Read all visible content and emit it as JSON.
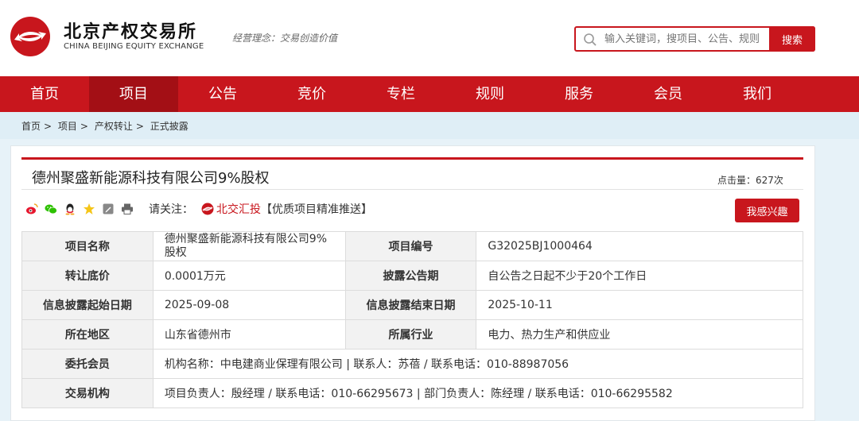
{
  "header": {
    "brand_cn": "北京产权交易所",
    "brand_en": "CHINA BEIJING EQUITY EXCHANGE",
    "slogan": "经营理念：交易创造价值",
    "search_placeholder": "输入关键词，搜项目、公告、规则…",
    "search_button": "搜索",
    "brand_color": "#c8161d"
  },
  "nav": [
    "首页",
    "项目",
    "公告",
    "竞价",
    "专栏",
    "规则",
    "服务",
    "会员",
    "我们"
  ],
  "nav_active": 1,
  "breadcrumb": [
    "首页",
    "项目",
    "产权转让",
    "正式披露"
  ],
  "project": {
    "title": "德州聚盛新能源科技有限公司9%股权",
    "clicks": "点击量：627次",
    "follow_label": "请关注：",
    "follow_name": "北交汇投",
    "follow_slogan": "【优质项目精准推送】",
    "interest_button": "我感兴趣",
    "share_icons": [
      "weibo-icon",
      "wechat-icon",
      "qq-icon",
      "star-icon",
      "edit-icon",
      "print-icon"
    ]
  },
  "rows": [
    {
      "k1": "项目名称",
      "v1": "德州聚盛新能源科技有限公司9%股权",
      "k2": "项目编号",
      "v2": "G32025BJ1000464"
    },
    {
      "k1": "转让底价",
      "v1": "0.0001万元",
      "k2": "披露公告期",
      "v2": "自公告之日起不少于20个工作日"
    },
    {
      "k1": "信息披露起始日期",
      "v1": "2025-09-08",
      "k2": "信息披露结束日期",
      "v2": "2025-10-11"
    },
    {
      "k1": "所在地区",
      "v1": "山东省德州市",
      "k2": "所属行业",
      "v2": "电力、热力生产和供应业"
    }
  ],
  "wide_rows": [
    {
      "k": "委托会员",
      "v": "机构名称：中电建商业保理有限公司 | 联系人：苏蓓 / 联系电话：010-88987056"
    },
    {
      "k": "交易机构",
      "v": "项目负责人：殷经理 / 联系电话：010-66295673 | 部门负责人：陈经理 / 联系电话：010-66295582"
    }
  ]
}
